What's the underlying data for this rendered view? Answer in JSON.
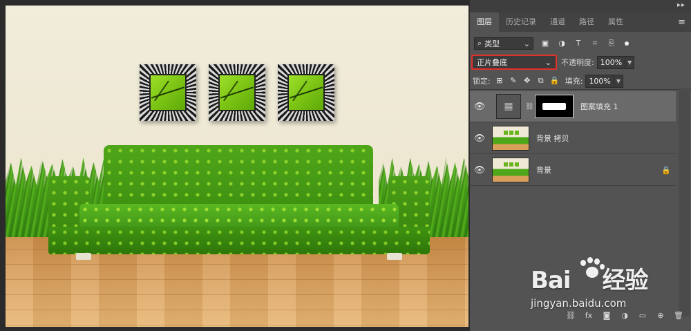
{
  "panel": {
    "tabs": [
      {
        "label": "图层",
        "active": true
      },
      {
        "label": "历史记录",
        "active": false
      },
      {
        "label": "通道",
        "active": false
      },
      {
        "label": "路径",
        "active": false
      },
      {
        "label": "属性",
        "active": false
      }
    ],
    "collapse_glyph": "▸▸",
    "menu_glyph": "≡",
    "filter": {
      "icon": "search-icon",
      "label": "类型",
      "chevron": "⌄"
    },
    "filter_icons": [
      "image-filter-icon",
      "adjustment-filter-icon",
      "type-filter-icon",
      "shape-filter-icon",
      "smart-object-filter-icon"
    ],
    "blend_mode": "正片叠底",
    "opacity_label": "不透明度:",
    "opacity_value": "100%",
    "lock_label": "锁定:",
    "fill_label": "填充:",
    "fill_value": "100%",
    "layers": [
      {
        "name": "图案填充 1",
        "visible": true,
        "selected": true,
        "type": "pattern-fill"
      },
      {
        "name": "背景 拷贝",
        "visible": true,
        "selected": false,
        "type": "image"
      },
      {
        "name": "背景",
        "visible": true,
        "selected": false,
        "type": "image",
        "locked": true
      }
    ]
  },
  "watermark": {
    "logo_left": "Bai",
    "logo_right": "经验",
    "url": "jingyan.baidu.com"
  },
  "colors": {
    "panel_bg": "#535353",
    "selected_layer": "#6a6a6a",
    "blend_highlight": "#e1312a"
  }
}
